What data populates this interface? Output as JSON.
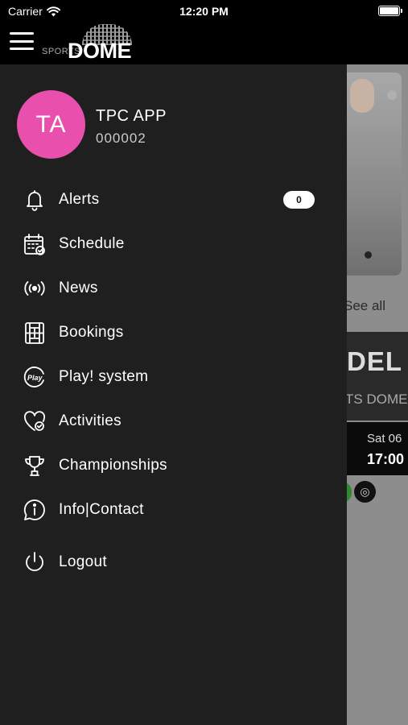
{
  "status_bar": {
    "carrier": "Carrier",
    "time": "12:20 PM"
  },
  "header": {
    "logo_small": "SPORTS",
    "logo_big": "DOME"
  },
  "profile": {
    "initials": "TA",
    "name": "TPC APP",
    "id": "000002"
  },
  "menu": [
    {
      "label": "Alerts",
      "icon": "bell-icon",
      "badge": "0"
    },
    {
      "label": "Schedule",
      "icon": "calendar-check-icon"
    },
    {
      "label": "News",
      "icon": "broadcast-icon"
    },
    {
      "label": "Bookings",
      "icon": "court-icon"
    },
    {
      "label": "Play! system",
      "icon": "play-badge-icon"
    },
    {
      "label": "Activities",
      "icon": "heart-check-icon"
    },
    {
      "label": "Championships",
      "icon": "trophy-icon"
    },
    {
      "label": "Info|Contact",
      "icon": "info-chat-icon"
    },
    {
      "label": "Logout",
      "icon": "power-icon"
    }
  ],
  "background": {
    "see_all": "See all",
    "banner_title": "DEL",
    "banner_sub": "TS DOME",
    "date": "Sat 06",
    "time": "17:00"
  },
  "colors": {
    "avatar": "#e94fac",
    "drawer": "#1f1f1f",
    "topbar": "#000000"
  }
}
